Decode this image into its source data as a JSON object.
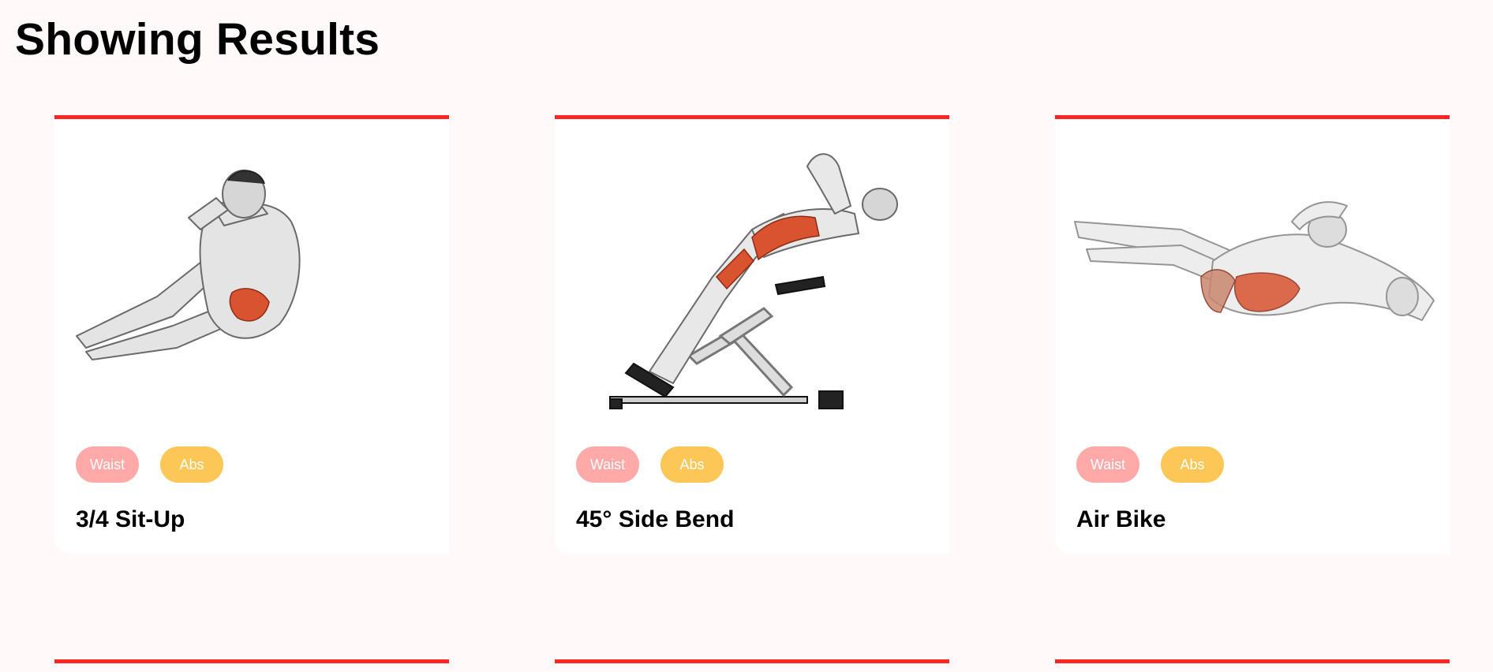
{
  "page": {
    "title": "Showing Results"
  },
  "colors": {
    "accent": "#ff2625",
    "background": "#fff9fa",
    "body_part_tag": "#ffa9a9",
    "target_tag": "#fcc757"
  },
  "exercises": [
    {
      "name": "3/4 Sit-Up",
      "body_part": "Waist",
      "target": "Abs",
      "image_icon": "sit-up-illustration"
    },
    {
      "name": "45° Side Bend",
      "body_part": "Waist",
      "target": "Abs",
      "image_icon": "side-bend-illustration"
    },
    {
      "name": "Air Bike",
      "body_part": "Waist",
      "target": "Abs",
      "image_icon": "air-bike-illustration"
    }
  ]
}
